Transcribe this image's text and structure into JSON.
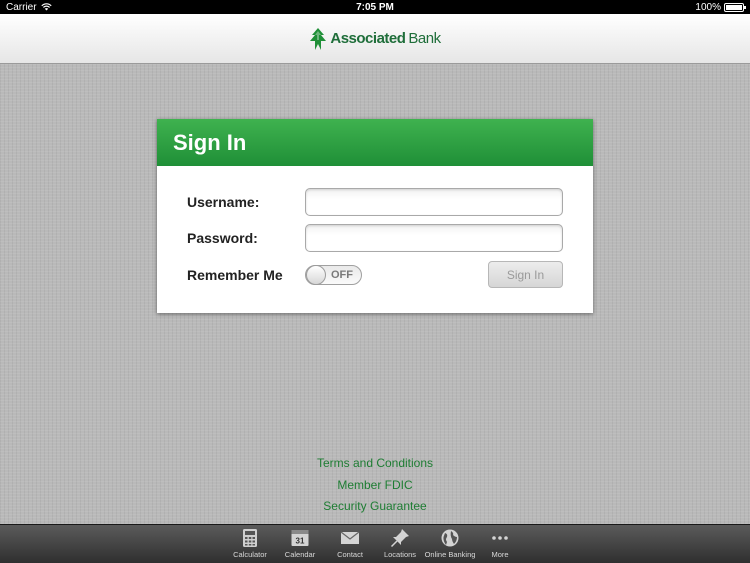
{
  "status_bar": {
    "carrier": "Carrier",
    "time": "7:05 PM",
    "battery": "100%"
  },
  "header": {
    "logo_text_bold": "Associated",
    "logo_text": "Bank"
  },
  "sign_in": {
    "title": "Sign In",
    "username_label": "Username:",
    "password_label": "Password:",
    "remember_label": "Remember Me",
    "remember_state": "OFF",
    "username_value": "",
    "password_value": "",
    "button_label": "Sign In"
  },
  "links": [
    "Terms and Conditions",
    "Member FDIC",
    "Security Guarantee"
  ],
  "tabbar": {
    "items": [
      {
        "label": "Calculator",
        "icon": "calculator-icon"
      },
      {
        "label": "Calendar",
        "icon": "calendar-icon",
        "day": "31"
      },
      {
        "label": "Contact",
        "icon": "envelope-icon"
      },
      {
        "label": "Locations",
        "icon": "pushpin-icon"
      },
      {
        "label": "Online Banking",
        "icon": "globe-icon"
      },
      {
        "label": "More",
        "icon": "more-icon"
      }
    ]
  },
  "colors": {
    "brand_green": "#1f8f37",
    "link_green": "#1e7d33"
  }
}
